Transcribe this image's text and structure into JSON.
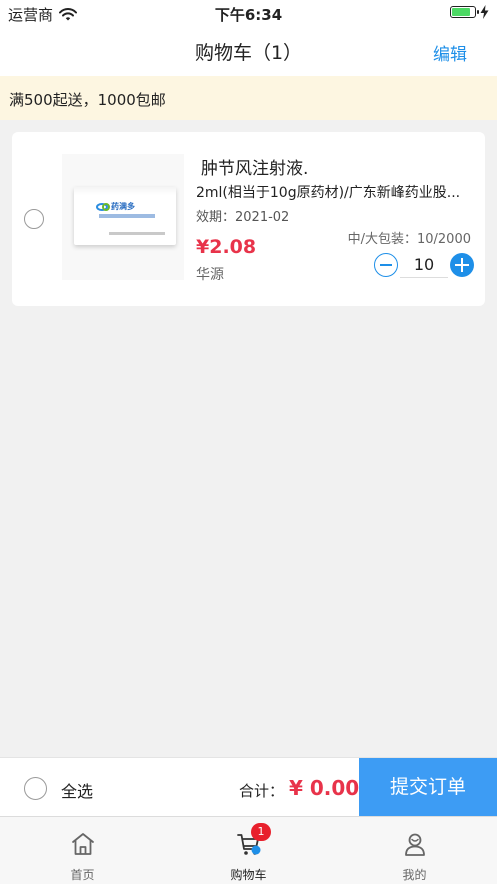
{
  "status": {
    "carrier": "运营商",
    "time": "下午6:34",
    "battery_level": 0.85
  },
  "nav": {
    "title": "购物车（1）",
    "edit_label": "编辑"
  },
  "notice": {
    "text": "满500起送，1000包邮"
  },
  "cart": {
    "items": [
      {
        "name": "肿节风注射液.",
        "spec": "2ml(相当于10g原药材)/广东新峰药业股...",
        "expiry": "效期：2021-02",
        "price": "¥2.08",
        "pack": "中/大包装：10/2000",
        "brand": "华源",
        "quantity": "10",
        "selected": false,
        "image": {
          "logo_text": "药满多"
        }
      }
    ]
  },
  "footer": {
    "select_all_label": "全选",
    "total_label": "合计：",
    "total_value": "¥ 0.00",
    "submit_label": "提交订单"
  },
  "tabbar": {
    "tabs": [
      {
        "label": "首页",
        "icon": "home-icon"
      },
      {
        "label": "购物车",
        "icon": "cart-icon",
        "badge": "1",
        "active": true
      },
      {
        "label": "我的",
        "icon": "profile-icon"
      }
    ]
  },
  "colors": {
    "accent": "#1e8fe8",
    "submit_bg": "#3d9cf4",
    "price": "#e8334a",
    "notice_bg": "#fdf6e1",
    "badge": "#e8202c"
  }
}
